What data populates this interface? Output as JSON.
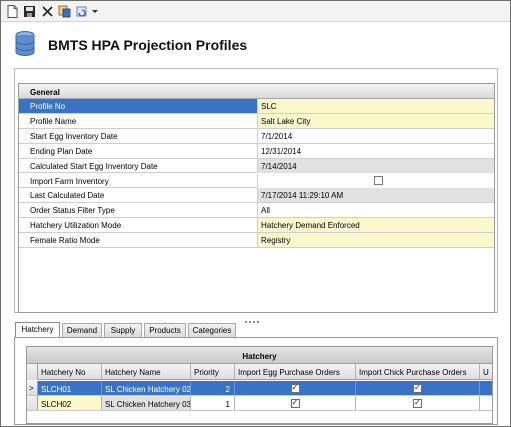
{
  "app": {
    "title": "BMTS HPA Projection Profiles"
  },
  "toolbar": {
    "icons": [
      "new-document-icon",
      "save-icon",
      "delete-icon",
      "copy-icon",
      "refresh-icon",
      "dropdown-arrow-icon"
    ]
  },
  "general": {
    "header": "General",
    "rows": [
      {
        "label": "Profile No",
        "value": "SLC",
        "style": "yellow",
        "selected": true
      },
      {
        "label": "Profile Name",
        "value": "Salt Lake City",
        "style": "yellow"
      },
      {
        "label": "Start Egg Inventory Date",
        "value": "7/1/2014",
        "style": "white"
      },
      {
        "label": "Ending Plan Date",
        "value": "12/31/2014",
        "style": "white"
      },
      {
        "label": "Calculated Start Egg Inventory Date",
        "value": "7/14/2014",
        "style": "grey"
      },
      {
        "label": "Import Farm Inventory",
        "value": "",
        "style": "white",
        "checkbox": true
      },
      {
        "label": "Last Calculated Date",
        "value": "7/17/2014 11:29:10 AM",
        "style": "grey"
      },
      {
        "label": "Order Status Filter Type",
        "value": "All",
        "style": "white"
      },
      {
        "label": "Hatchery Utilization Mode",
        "value": "Hatchery Demand Enforced",
        "style": "yellow"
      },
      {
        "label": "Female Ratio Mode",
        "value": "Registry",
        "style": "yellow"
      }
    ]
  },
  "tabs": [
    "Hatchery",
    "Demand",
    "Supply",
    "Products",
    "Categories"
  ],
  "active_tab": "Hatchery",
  "hatchery_grid": {
    "title": "Hatchery",
    "columns": [
      "Hatchery No",
      "Hatchery Name",
      "Priority",
      "Import Egg Purchase Orders",
      "Import Chick Purchase Orders",
      "U"
    ],
    "rows": [
      {
        "no": "SLCH01",
        "name": "SL Chicken Hatchery 02",
        "priority": "2",
        "egg": true,
        "chick": true,
        "selected": true
      },
      {
        "no": "SLCH02",
        "name": "SL Chicken Hatchery 03",
        "priority": "1",
        "egg": true,
        "chick": true,
        "selected": false
      }
    ],
    "row_indicator": ">"
  },
  "colors": {
    "selection": "#3a73c4",
    "editable": "#fbf8cc",
    "readonly": "#e1e1e1"
  }
}
